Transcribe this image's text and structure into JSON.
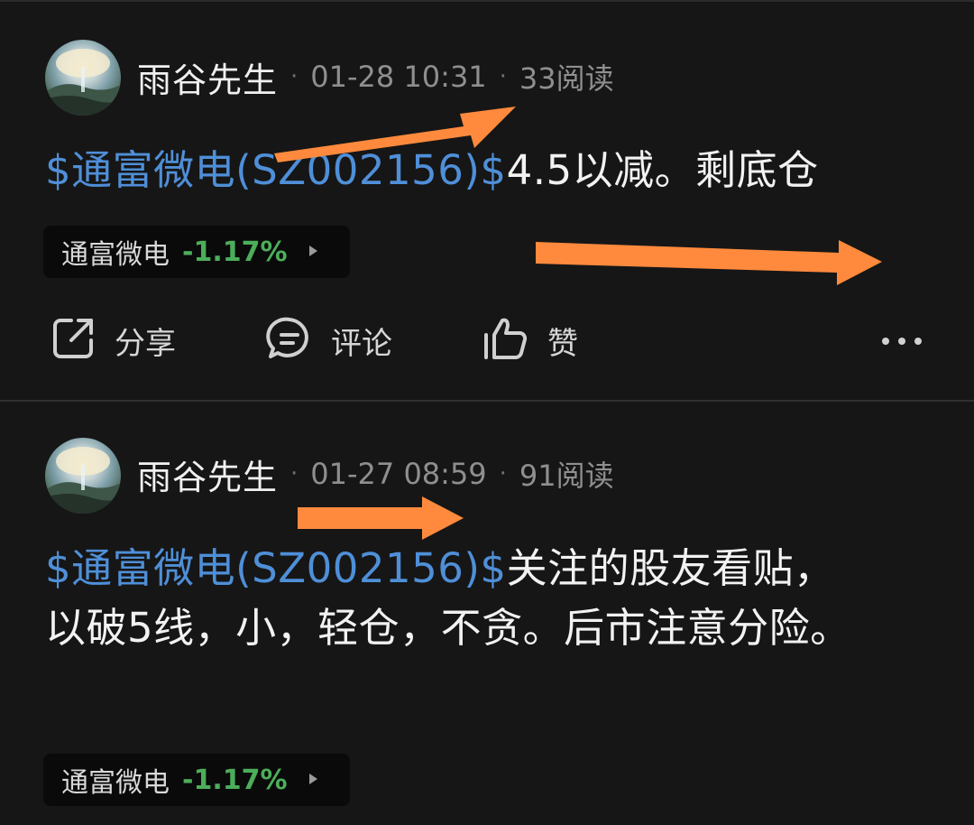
{
  "posts": [
    {
      "author": "雨谷先生",
      "time": "01-28 10:31",
      "reads": "33阅读",
      "stock_link": "$通富微电(SZ002156)$",
      "text": "4.5以减。剩底仓",
      "chip": {
        "name": "通富微电",
        "change": "-1.17%"
      },
      "actions": {
        "share": "分享",
        "comment": "评论",
        "like": "赞"
      }
    },
    {
      "author": "雨谷先生",
      "time": "01-27 08:59",
      "reads": "91阅读",
      "stock_link": "$通富微电(SZ002156)$",
      "text": "关注的股友看贴，以破5线，小，轻仓，不贪。后市注意分险。",
      "chip": {
        "name": "通富微电",
        "change": "-1.17%"
      }
    }
  ],
  "separator": "·",
  "icons": [
    "avatar-landscape",
    "share-icon",
    "comment-icon",
    "like-icon",
    "more-icon",
    "chevron-right-icon"
  ],
  "colors": {
    "background": "#161616",
    "link": "#4f8fd8",
    "negative_change": "#4cae5a",
    "annotation_arrow": "#ff8a3d"
  }
}
